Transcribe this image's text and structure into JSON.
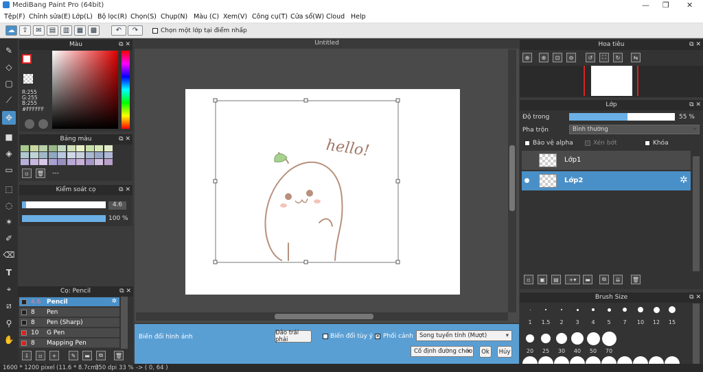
{
  "window": {
    "title": "MediBang Paint Pro (64bit)",
    "min": "—",
    "max": "❐",
    "close": "✕"
  },
  "menu": [
    "Tệp(F)",
    "Chỉnh sửa(E)",
    "Lớp(L)",
    "Bộ lọc(R)",
    "Chọn(S)",
    "Chụp(N)",
    "Màu (C)",
    "Xem(V)",
    "Công cụ(T)",
    "Cửa sổ(W)",
    "Cloud",
    "Help"
  ],
  "toolbar": {
    "checkbox_label": "Chọn một lớp tại điểm nhấp"
  },
  "color_panel": {
    "title": "Màu",
    "r": "R:255",
    "g": "G:255",
    "b": "B:255",
    "hex": "#FFFFFF"
  },
  "palette_panel": {
    "title": "Bảng màu",
    "dash": "---"
  },
  "brush_control": {
    "title": "Kiểm soát cọ",
    "size": "4.6",
    "opacity": "100 %",
    "opacity_value": 1.0,
    "size_value": 0.05
  },
  "brush_panel": {
    "title": "Cọ: Pencil",
    "items": [
      {
        "size": "4.6",
        "name": "Pencil",
        "color": "#222222"
      },
      {
        "size": "8",
        "name": "Pen",
        "color": "#222222"
      },
      {
        "size": "8",
        "name": "Pen (Sharp)",
        "color": "#222222"
      },
      {
        "size": "10",
        "name": "G Pen",
        "color": "#e02020"
      },
      {
        "size": "8",
        "name": "Mapping Pen",
        "color": "#e02020"
      }
    ]
  },
  "document": {
    "tab": "Untitled",
    "drawing_text": "hello!"
  },
  "transform_bar": {
    "label": "Biến đổi hình ảnh",
    "flip": "Đảo trái phải",
    "free": "Biến đổi tùy ý",
    "perspective": "Phối cảnh",
    "interp": "Song tuyến tính (Mượt)",
    "fix": "Cố định đường chéo",
    "ok": "Ok",
    "cancel": "Hủy"
  },
  "navigator": {
    "title": "Hoa tiêu"
  },
  "layer_panel": {
    "title": "Lớp",
    "opacity_label": "Độ trong",
    "opacity": "55 %",
    "opacity_value": 0.55,
    "blend_label": "Pha trộn",
    "blend": "Bình thường",
    "protect": "Bảo vệ alpha",
    "clip": "Xén bớt",
    "lock": "Khóa",
    "layers": [
      "Lớp1",
      "Lớp2"
    ]
  },
  "brush_size": {
    "title": "Brush Size",
    "sizes": [
      "1",
      "1.5",
      "2",
      "3",
      "4",
      "5",
      "7",
      "10",
      "12",
      "15",
      "20",
      "25",
      "30",
      "40",
      "50",
      "70"
    ]
  },
  "status": {
    "dims": "1600 * 1200 pixel",
    "cm": "(11.6 * 8.7cm)",
    "dpi": "350 dpi",
    "zoom": "33 %",
    "coords": "-> ( 0, 64 )"
  }
}
